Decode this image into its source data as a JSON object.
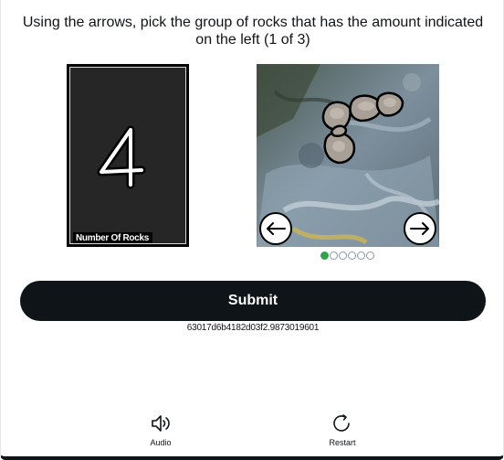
{
  "prompt": {
    "text": "Using the arrows, pick the group of rocks that has the amount indicated on the left (1 of 3)"
  },
  "reference_card": {
    "digit": "4",
    "caption": "Number Of Rocks"
  },
  "carousel": {
    "total_images": 6,
    "current_index": 1,
    "rocks_in_image": 5
  },
  "submit": {
    "label": "Submit"
  },
  "session_id": "63017d6b4182d03f2.9873019601",
  "footer": {
    "audio_label": "Audio",
    "restart_label": "Restart"
  },
  "colors": {
    "primary_button": "#0f1419",
    "active_dot": "#31a24c",
    "inactive_dot_border": "#8b98a5"
  },
  "icons": {
    "prev": "arrow-left-icon",
    "next": "arrow-right-icon",
    "audio": "speaker-icon",
    "restart": "refresh-icon"
  }
}
